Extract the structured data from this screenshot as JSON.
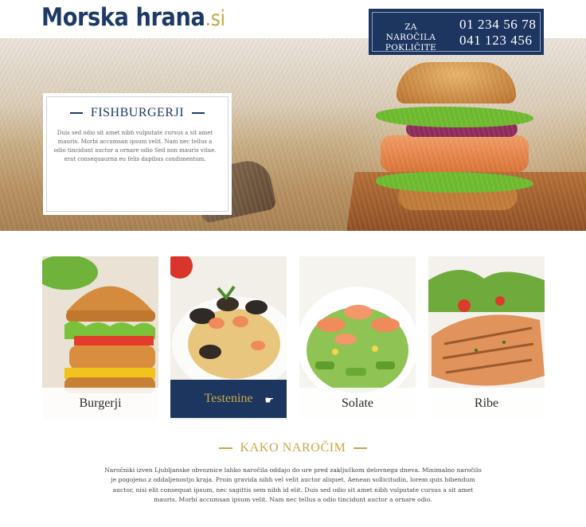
{
  "header": {
    "logo_main": "Morska hrana",
    "logo_tld": ".si",
    "order_label_line1": "ZA NAROČILA",
    "order_label_line2": "POKLIČITE",
    "phone_1": "01 234 56 78",
    "phone_2": "041 123 456"
  },
  "hero": {
    "title": "FISHBURGERJI",
    "text": "Duis sed odio sit amet nibh vulputate cursus a sit amet mauris. Morbi accumsan ipsum velit. Nam nec tellus a odio tincidunt auctor a ornare odio Sed non  mauris vitae.  erat consequaurna eu felis dapibus condimentum."
  },
  "categories": [
    {
      "label": "Burgerji",
      "active": false
    },
    {
      "label": "Testenine",
      "active": true
    },
    {
      "label": "Solate",
      "active": false
    },
    {
      "label": "Ribe",
      "active": false
    }
  ],
  "how_to_order": {
    "title": "KAKO NAROČIM",
    "text": "Naročniki izven Ljubljanske obvoznice lahko naročila oddajo do ure pred zaključkom delovnega dneva. Minimalno naročilo je pogojeno z oddaljenostjo kraja. Proin gravida nibh vel velit auctor aliquet. Aenean sollicitudin, lorem quis bibendum auctor, nisi elit consequat ipsum, nec sagittis sem nibh id elit. Duis sed odio sit amet nibh vulputate cursus a sit amet mauris.  Morbi accumsan ipsum velit.  Nam nec tellus a odio tincidunt auctor a ornare odio."
  },
  "colors": {
    "brand_navy": "#1c3660",
    "accent_gold": "#c7a847"
  }
}
